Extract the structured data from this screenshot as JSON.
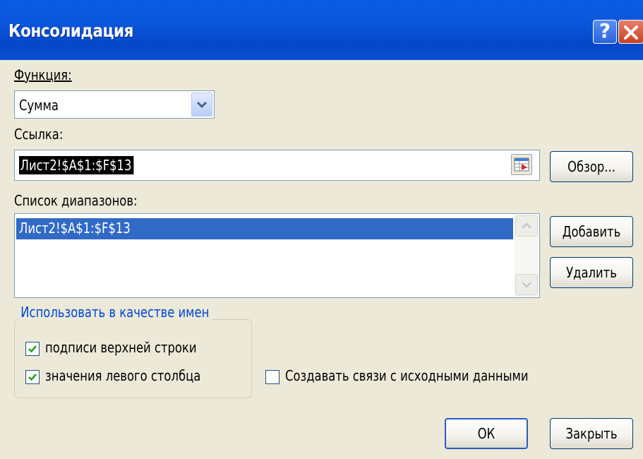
{
  "window": {
    "title": "Консолидация"
  },
  "function": {
    "label": "Функция:",
    "selected": "Сумма"
  },
  "reference": {
    "label": "Ссылка:",
    "value": "Лист2!$A$1:$F$13",
    "browse_label": "Обзор..."
  },
  "ranges": {
    "label": "Список диапазонов:",
    "items": [
      "Лист2!$A$1:$F$13"
    ],
    "add_label": "Добавить",
    "delete_label": "Удалить"
  },
  "use_labels": {
    "legend": "Использовать в качестве имен",
    "top_row": {
      "label": "подписи верхней строки",
      "checked": true
    },
    "left_column": {
      "label": "значения левого столбца",
      "checked": true
    }
  },
  "create_links": {
    "label": "Создавать связи с исходными данными",
    "checked": false
  },
  "buttons": {
    "ok": "ОК",
    "close": "Закрыть"
  },
  "colors": {
    "titlebar": "#0a5be6",
    "dialog": "#ece9d8",
    "selection": "#316ac5",
    "legend": "#0046d5",
    "check": "#21a121"
  }
}
